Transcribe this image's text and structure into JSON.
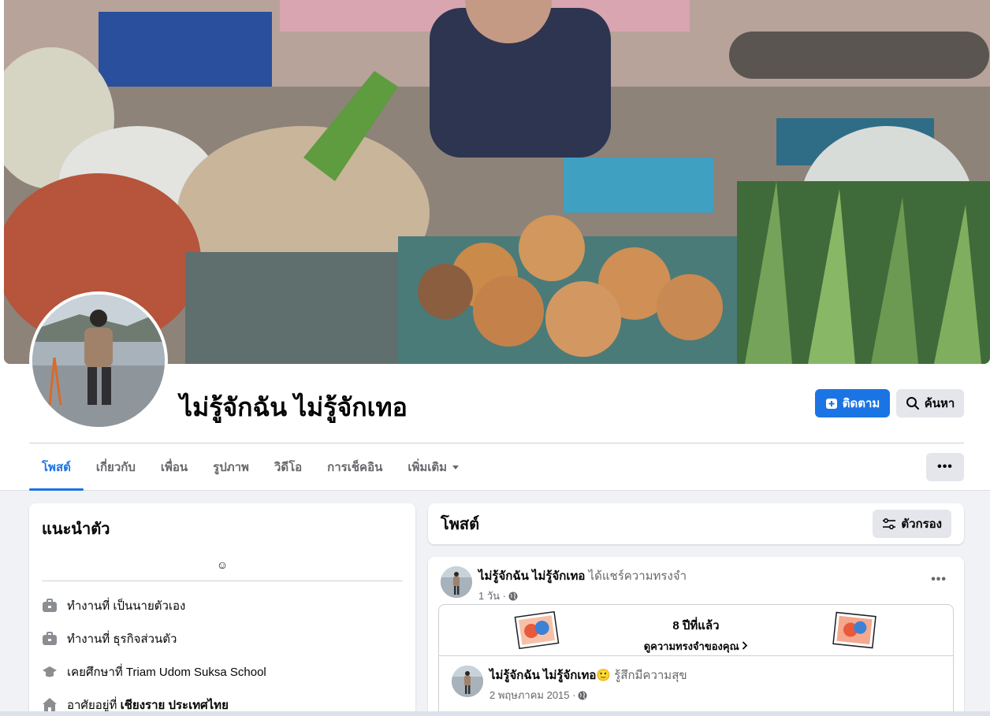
{
  "profile": {
    "name": "ไม่รู้จักฉัน ไม่รู้จักเทอ",
    "follow_label": "ติดตาม",
    "search_label": "ค้นหา",
    "more_label": "•••"
  },
  "tabs": [
    {
      "label": "โพสต์"
    },
    {
      "label": "เกี่ยวกับ"
    },
    {
      "label": "เพื่อน"
    },
    {
      "label": "รูปภาพ"
    },
    {
      "label": "วิดีโอ"
    },
    {
      "label": "การเช็คอิน"
    },
    {
      "label": "เพิ่มเติม"
    }
  ],
  "intro": {
    "title": "แนะนำตัว",
    "bio": "☺",
    "items": [
      {
        "icon": "briefcase-icon",
        "text": "ทำงานที่ เป็นนายตัวเอง"
      },
      {
        "icon": "briefcase-icon",
        "text": "ทำงานที่ ธุรกิจส่วนตัว"
      },
      {
        "icon": "graduation-cap-icon",
        "text": "เคยศึกษาที่ Triam Udom Suksa School"
      },
      {
        "icon": "home-icon",
        "text_prefix": "อาศัยอยู่ที่ ",
        "text_bold": "เชียงราย ประเทศไทย"
      }
    ]
  },
  "posts": {
    "title": "โพสต์",
    "filter_label": "ตัวกรอง",
    "post": {
      "author": "ไม่รู้จักฉัน ไม่รู้จักเทอ",
      "action": "ได้แชร์ความทรงจำ",
      "time": "1 วัน ·",
      "more_label": "•••",
      "memory": {
        "years": "8 ปีที่แล้ว",
        "link": "ดูความทรงจำของคุณ"
      },
      "inner": {
        "author": "ไม่รู้จักฉัน ไม่รู้จักเทอ",
        "emoji": "🙂",
        "feeling": "รู้สึกมีความสุข",
        "date": "2 พฤษภาคม 2015 ·"
      }
    }
  },
  "colors": {
    "accent": "#1b74e4",
    "background": "#f0f2f5",
    "secondary_button": "#e4e6eb",
    "muted_text": "#65676b"
  }
}
